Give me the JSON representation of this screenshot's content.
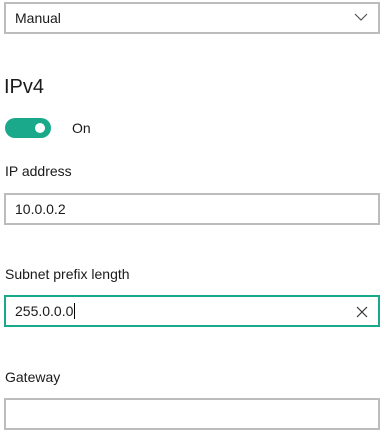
{
  "mode_select": {
    "value": "Manual"
  },
  "ipv4": {
    "title": "IPv4",
    "toggle_state": "On",
    "accent_color": "#1ba98c"
  },
  "ip_address": {
    "label": "IP address",
    "value": "10.0.0.2"
  },
  "subnet": {
    "label": "Subnet prefix length",
    "value": "255.0.0.0"
  },
  "gateway": {
    "label": "Gateway",
    "value": ""
  },
  "icons": {
    "dropdown": "chevron-down-icon",
    "clear": "close-icon"
  }
}
